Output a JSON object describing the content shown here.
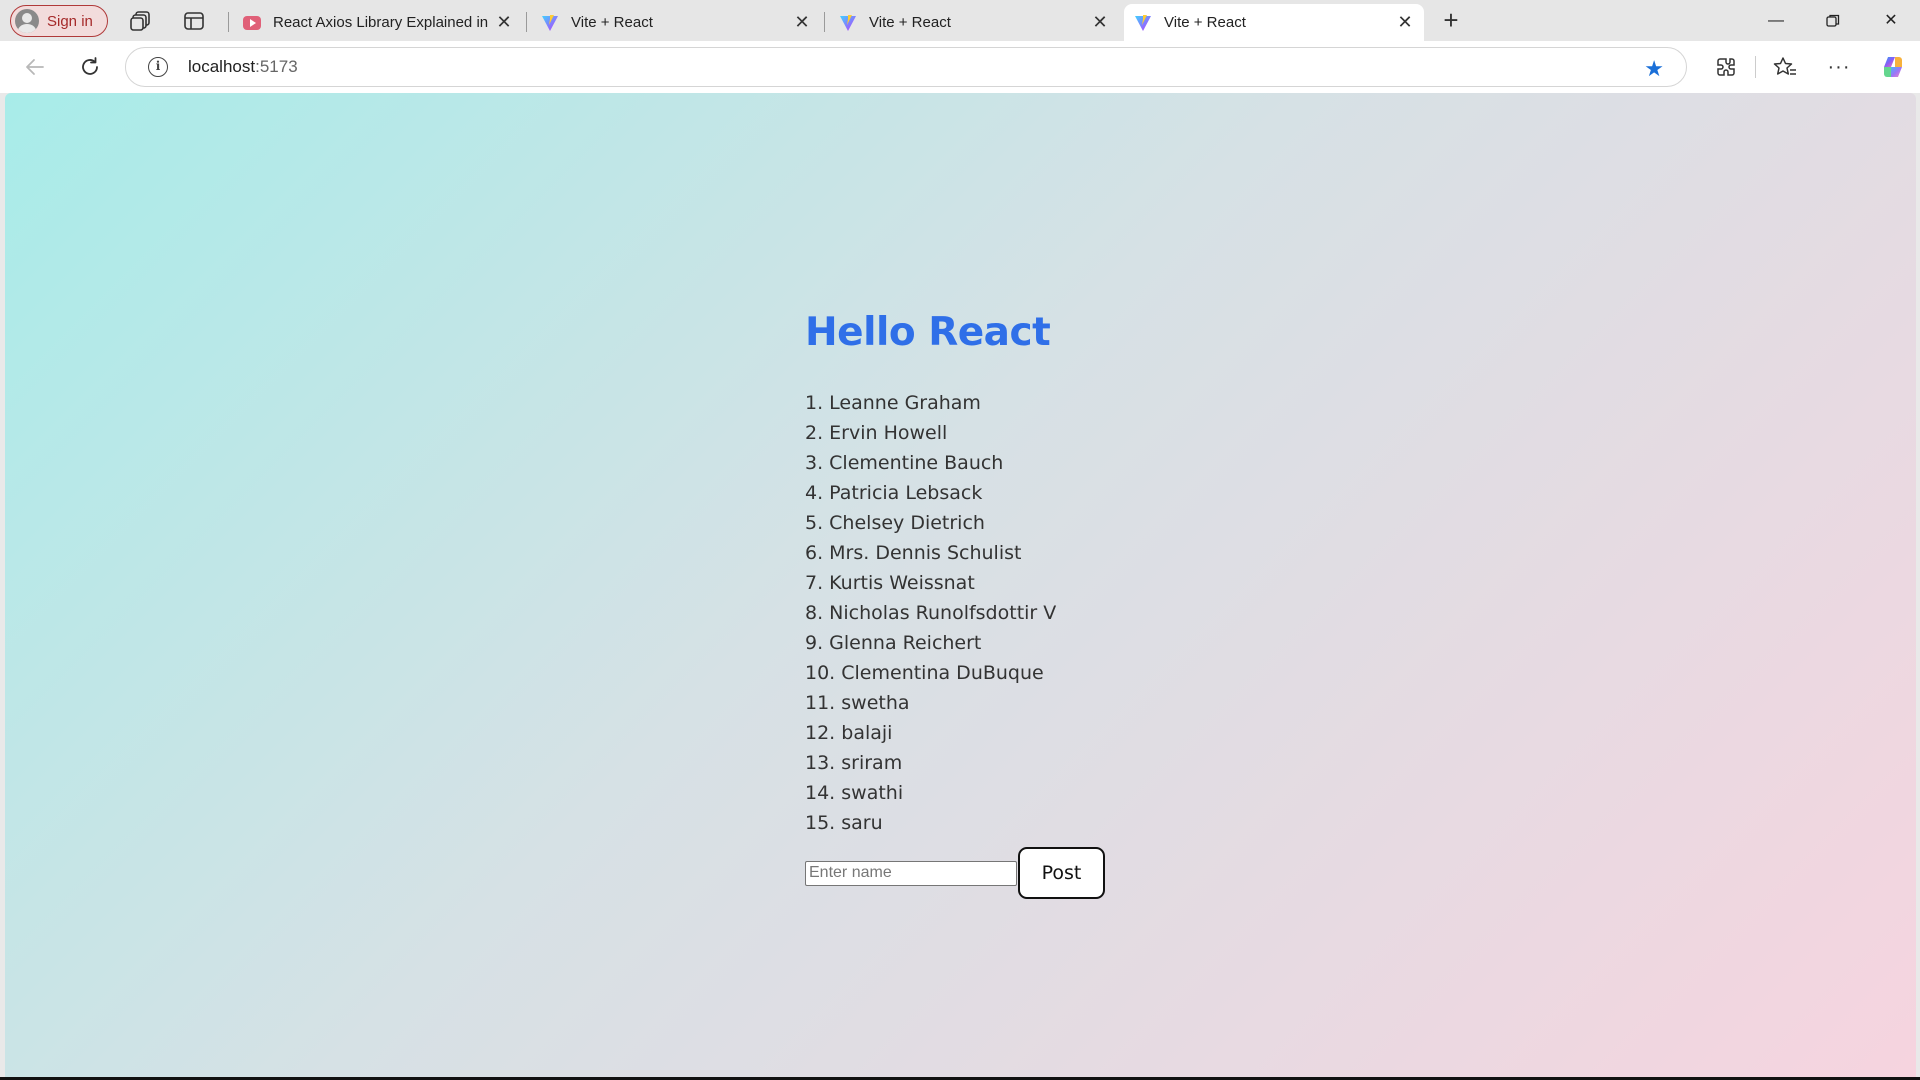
{
  "browser": {
    "signin_label": "Sign in",
    "tabs": [
      {
        "title": "React Axios Library Explained in Tamil",
        "favicon": "youtube-icon"
      },
      {
        "title": "Vite + React",
        "favicon": "vite-icon"
      },
      {
        "title": "Vite + React",
        "favicon": "vite-icon"
      },
      {
        "title": "Vite + React",
        "favicon": "vite-icon",
        "active": true
      }
    ],
    "address": {
      "host": "localhost",
      "port": ":5173"
    },
    "accent_color": "#1a6fd8"
  },
  "page": {
    "heading": "Hello React",
    "heading_color": "#2f6fe8",
    "users": [
      "1. Leanne Graham",
      "2. Ervin Howell",
      "3. Clementine Bauch",
      "4. Patricia Lebsack",
      "5. Chelsey Dietrich",
      "6. Mrs. Dennis Schulist",
      "7. Kurtis Weissnat",
      "8. Nicholas Runolfsdottir V",
      "9. Glenna Reichert",
      "10. Clementina DuBuque",
      "11. swetha",
      "12. balaji",
      "13. sriram",
      "14. swathi",
      "15. saru"
    ],
    "name_input": {
      "value": "",
      "placeholder": "Enter name"
    },
    "post_label": "Post"
  }
}
